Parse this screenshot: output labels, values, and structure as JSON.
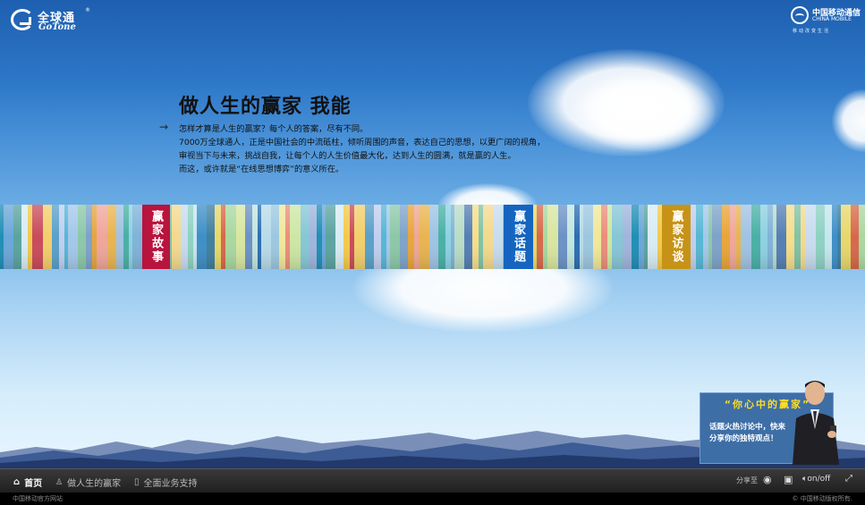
{
  "brand": {
    "gotone_cn": "全球通",
    "gotone_en": "GoTone",
    "gotone_reg": "®",
    "cm_cn": "中国移动通信",
    "cm_en": "CHINA MOBILE",
    "cm_tag": "移动改变生活"
  },
  "hero": {
    "headline": "做人生的赢家  我能",
    "arrow": "→",
    "lines": [
      "怎样才算是人生的赢家？每个人的答案，尽有不同。",
      "7000万全球通人，正是中国社会的中流砥柱，倾听周围的声音，表达自己的思想，以更广阔的视角，",
      "审视当下与未来，挑战自我，让每个人的人生价值最大化，达到人生的圆满，就是赢的人生。",
      "而这，或许就是“在线思想博弈”的意义所在。"
    ]
  },
  "tabs": {
    "story": "赢家故事",
    "topic": "赢家话题",
    "interview": "赢家访谈"
  },
  "promo": {
    "quote": "“你心中的赢家”",
    "line1": "话题火热讨论中，快来",
    "line2": "分享你的独特观点！"
  },
  "nav": {
    "home": "首页",
    "win": "做人生的赢家",
    "support": "全面业务支持",
    "share": "分享至",
    "sound": "on/off"
  },
  "footer": {
    "left": "中国移动官方网站",
    "right": "© 中国移动版权所有."
  },
  "colors": {
    "tab_story": "#b8143d",
    "tab_topic": "#1565c0",
    "tab_interview": "#c79317",
    "navbar": "#2a2a2a"
  }
}
